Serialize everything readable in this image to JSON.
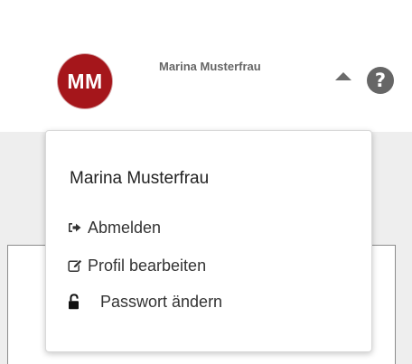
{
  "header": {
    "avatar_initials": "MM",
    "user_name": "Marina Musterfrau",
    "help_icon": "question-circle-icon",
    "caret_icon": "caret-up-icon"
  },
  "dropdown": {
    "title": "Marina Musterfrau",
    "items": [
      {
        "label": "Abmelden",
        "icon": "sign-out-icon"
      },
      {
        "label": "Profil bearbeiten",
        "icon": "edit-icon"
      },
      {
        "label": "Passwort ändern",
        "icon": "unlock-icon"
      }
    ]
  },
  "colors": {
    "avatar_bg": "#a5161b",
    "band_bg": "#eeeeee",
    "header_text": "#666666",
    "menu_text": "#333333"
  }
}
